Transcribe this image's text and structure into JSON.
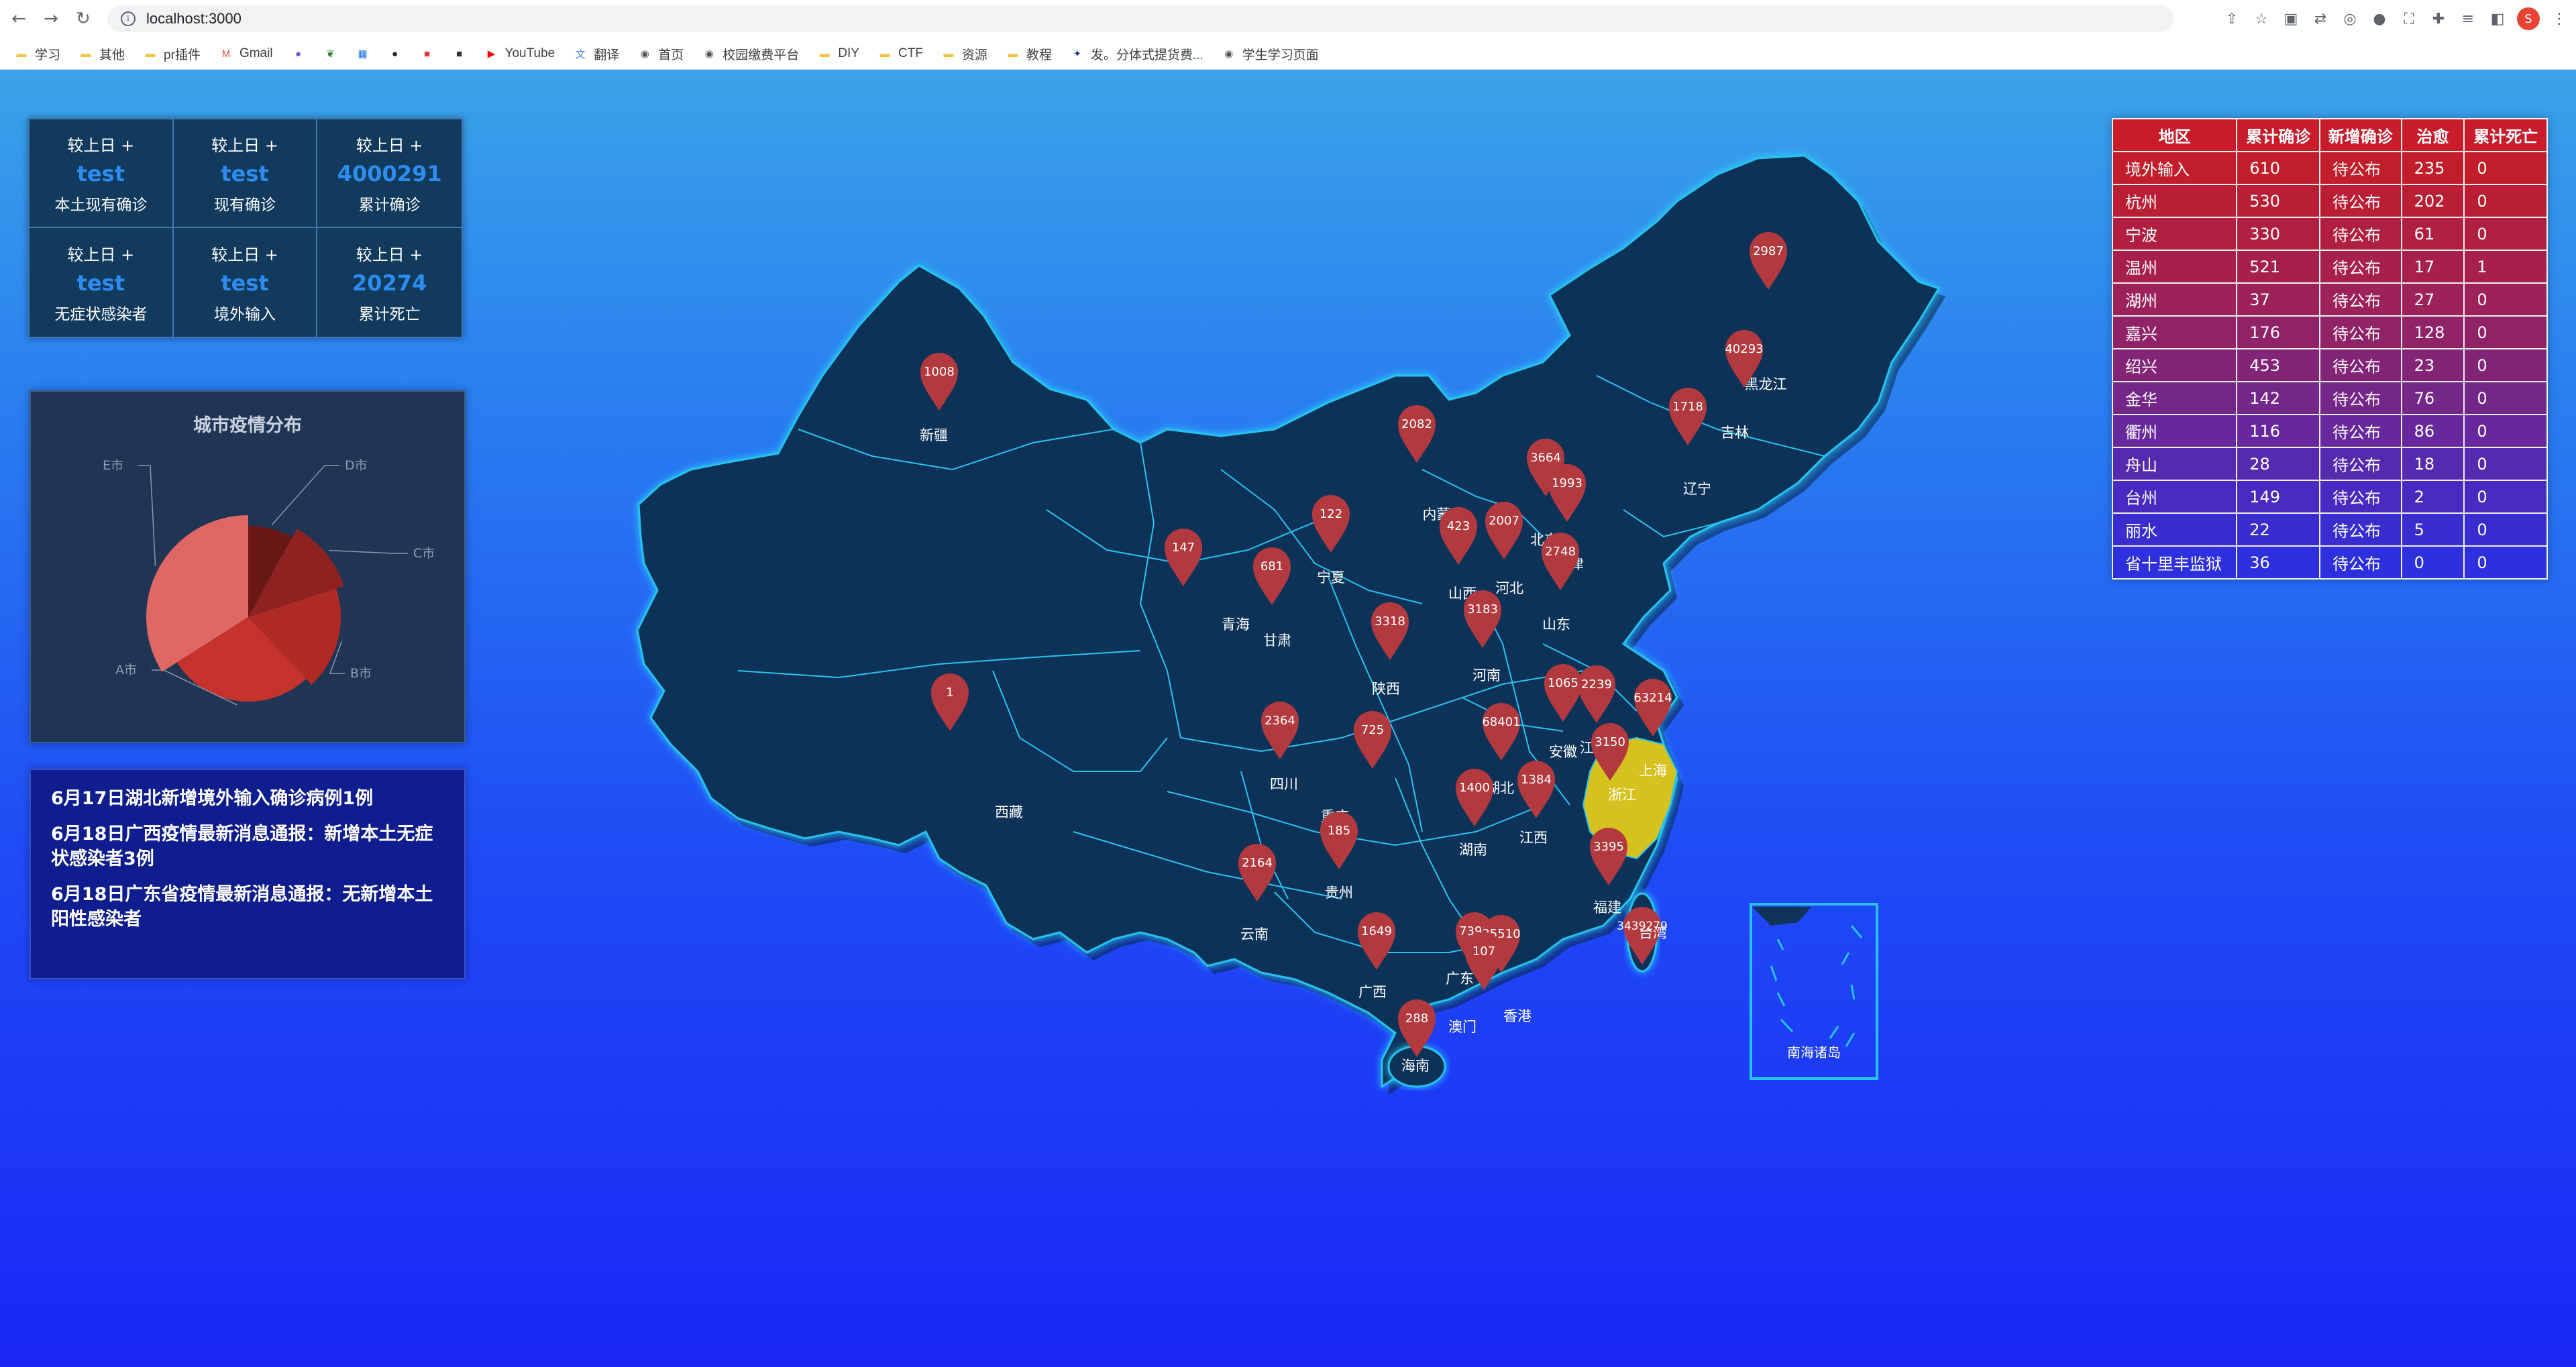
{
  "browser": {
    "url": "localhost:3000",
    "bookmarks": [
      {
        "label": "学习",
        "icon": "folder-icon"
      },
      {
        "label": "其他",
        "icon": "folder-icon"
      },
      {
        "label": "pr插件",
        "icon": "folder-icon"
      },
      {
        "label": "Gmail",
        "icon": "gmail-icon"
      },
      {
        "label": "",
        "icon": "blue-circle-icon"
      },
      {
        "label": "",
        "icon": "leaf-icon"
      },
      {
        "label": "",
        "icon": "calendar-icon"
      },
      {
        "label": "",
        "icon": "github-icon"
      },
      {
        "label": "",
        "icon": "red-app-icon"
      },
      {
        "label": "",
        "icon": "dark-app-icon"
      },
      {
        "label": "YouTube",
        "icon": "youtube-icon"
      },
      {
        "label": "翻译",
        "icon": "translate-icon"
      },
      {
        "label": "首页",
        "icon": "globe-icon"
      },
      {
        "label": "校园缴费平台",
        "icon": "globe-icon"
      },
      {
        "label": "DIY",
        "icon": "folder-icon"
      },
      {
        "label": "CTF",
        "icon": "folder-icon"
      },
      {
        "label": "资源",
        "icon": "folder-icon"
      },
      {
        "label": "教程",
        "icon": "folder-icon"
      },
      {
        "label": "发。分体式提货费...",
        "icon": "paw-icon"
      },
      {
        "label": "学生学习页面",
        "icon": "globe-icon"
      }
    ],
    "avatar_letter": "S"
  },
  "stats": [
    {
      "top": "较上日 +",
      "value": "test",
      "label": "本土现有确诊"
    },
    {
      "top": "较上日 +",
      "value": "test",
      "label": "现有确诊"
    },
    {
      "top": "较上日 +",
      "value": "4000291",
      "label": "累计确诊"
    },
    {
      "top": "较上日 +",
      "value": "test",
      "label": "无症状感染者"
    },
    {
      "top": "较上日 +",
      "value": "test",
      "label": "境外输入"
    },
    {
      "top": "较上日 +",
      "value": "20274",
      "label": "累计死亡"
    }
  ],
  "pie": {
    "title": "城市疫情分布",
    "slices": [
      {
        "name": "A市",
        "value": 28,
        "color": "#c6322c"
      },
      {
        "name": "B市",
        "value": 18,
        "color": "#b02a25"
      },
      {
        "name": "C市",
        "value": 12,
        "color": "#8d2221"
      },
      {
        "name": "D市",
        "value": 8,
        "color": "#6a1816"
      },
      {
        "name": "E市",
        "value": 34,
        "color": "#e06864"
      }
    ]
  },
  "news": [
    "6月17日湖北新增境外输入确诊病例1例",
    "6月18日广西疫情最新消息通报：新增本土无症状感染者3例",
    "6月18日广东省疫情最新消息通报：无新增本土阳性感染者"
  ],
  "table": {
    "headers": [
      "地区",
      "累计确诊",
      "新增确诊",
      "治愈",
      "累计死亡"
    ],
    "rows": [
      [
        "境外输入",
        "610",
        "待公布",
        "235",
        "0"
      ],
      [
        "杭州",
        "530",
        "待公布",
        "202",
        "0"
      ],
      [
        "宁波",
        "330",
        "待公布",
        "61",
        "0"
      ],
      [
        "温州",
        "521",
        "待公布",
        "17",
        "1"
      ],
      [
        "湖州",
        "37",
        "待公布",
        "27",
        "0"
      ],
      [
        "嘉兴",
        "176",
        "待公布",
        "128",
        "0"
      ],
      [
        "绍兴",
        "453",
        "待公布",
        "23",
        "0"
      ],
      [
        "金华",
        "142",
        "待公布",
        "76",
        "0"
      ],
      [
        "衢州",
        "116",
        "待公布",
        "86",
        "0"
      ],
      [
        "舟山",
        "28",
        "待公布",
        "18",
        "0"
      ],
      [
        "台州",
        "149",
        "待公布",
        "2",
        "0"
      ],
      [
        "丽水",
        "22",
        "待公布",
        "5",
        "0"
      ],
      [
        "省十里丰监狱",
        "36",
        "待公布",
        "0",
        "0"
      ]
    ],
    "row_colors": [
      "#c21d2b",
      "#ba1e35",
      "#b11f40",
      "#a7204c",
      "#9c2259",
      "#902367",
      "#832577",
      "#752689",
      "#66289c",
      "#562aae",
      "#472bc0",
      "#392dd0",
      "#2e2fdd"
    ]
  },
  "map": {
    "highlight_color": "#d6c21f",
    "region_color": "#103358",
    "border_color": "#27c3ee",
    "pins": [
      {
        "v": "1008",
        "name": "新疆"
      },
      {
        "v": "2987",
        "name": "黑龙江"
      },
      {
        "v": "40293",
        "name": "吉林"
      },
      {
        "v": "1718",
        "name": "辽宁"
      },
      {
        "v": "2082",
        "name": "内蒙古"
      },
      {
        "v": "3664",
        "name": "北京"
      },
      {
        "v": "1993",
        "name": "天津"
      },
      {
        "v": "122",
        "name": "宁夏"
      },
      {
        "v": "423",
        "name": "山西"
      },
      {
        "v": "2007",
        "name": "河北"
      },
      {
        "v": "147",
        "name": "青海"
      },
      {
        "v": "681",
        "name": "甘肃"
      },
      {
        "v": "2748",
        "name": "山东"
      },
      {
        "v": "3183",
        "name": "河南"
      },
      {
        "v": "3318",
        "name": "陕西"
      },
      {
        "v": "1",
        "name": "西藏"
      },
      {
        "v": "1065",
        "name": "安徽"
      },
      {
        "v": "2239",
        "name": "江苏"
      },
      {
        "v": "63214",
        "name": "上海"
      },
      {
        "v": "2364",
        "name": "四川"
      },
      {
        "v": "725",
        "name": "重庆"
      },
      {
        "v": "68401",
        "name": "湖北"
      },
      {
        "v": "3150",
        "name": "浙江"
      },
      {
        "v": "1384",
        "name": "江西"
      },
      {
        "v": "1400",
        "name": "湖南"
      },
      {
        "v": "185",
        "name": "贵州"
      },
      {
        "v": "2164",
        "name": "云南"
      },
      {
        "v": "3395",
        "name": "福建"
      },
      {
        "v": "1649",
        "name": "广西"
      },
      {
        "v": "7391",
        "name": "广东"
      },
      {
        "v": "35510",
        "name": "香港"
      },
      {
        "v": "107",
        "name": "澳门"
      },
      {
        "v": "3439279",
        "name": "台湾"
      },
      {
        "v": "288",
        "name": "海南"
      }
    ],
    "inset_label": "南海诸岛"
  }
}
